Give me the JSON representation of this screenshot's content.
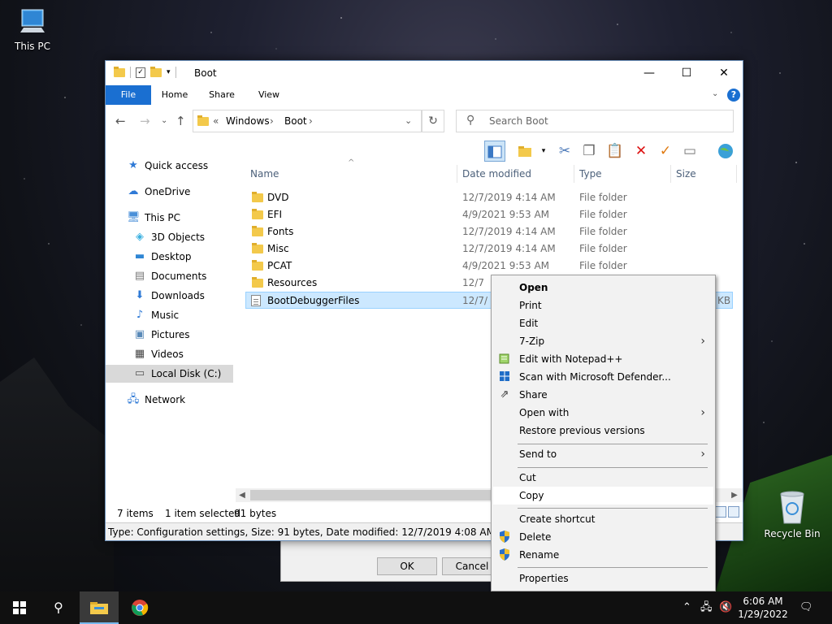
{
  "desktop": {
    "this_pc_label": "This PC",
    "recycle_bin_label": "Recycle Bin"
  },
  "window": {
    "title": "Boot",
    "controls": {
      "minimize": "—",
      "maximize": "☐",
      "close": "✕"
    },
    "ribbon_tabs": [
      "File",
      "Home",
      "Share",
      "View"
    ],
    "address": {
      "prefix": "«",
      "crumbs": [
        "Windows",
        "Boot"
      ]
    },
    "search_placeholder": "Search Boot",
    "nav_pane": [
      {
        "label": "Quick access",
        "icon": "star-icon"
      },
      {
        "label": "OneDrive",
        "icon": "cloud-icon"
      },
      {
        "label": "This PC",
        "icon": "computer-icon"
      },
      {
        "label": "3D Objects",
        "icon": "cube-icon"
      },
      {
        "label": "Desktop",
        "icon": "desktop-icon"
      },
      {
        "label": "Documents",
        "icon": "documents-icon"
      },
      {
        "label": "Downloads",
        "icon": "download-icon"
      },
      {
        "label": "Music",
        "icon": "music-icon"
      },
      {
        "label": "Pictures",
        "icon": "pictures-icon"
      },
      {
        "label": "Videos",
        "icon": "videos-icon"
      },
      {
        "label": "Local Disk (C:)",
        "icon": "drive-icon",
        "selected": true
      },
      {
        "label": "Network",
        "icon": "network-icon"
      }
    ],
    "columns": {
      "name": "Name",
      "date": "Date modified",
      "type": "Type",
      "size": "Size"
    },
    "files": [
      {
        "name": "DVD",
        "date": "12/7/2019 4:14 AM",
        "type": "File folder",
        "size": ""
      },
      {
        "name": "EFI",
        "date": "4/9/2021 9:53 AM",
        "type": "File folder",
        "size": ""
      },
      {
        "name": "Fonts",
        "date": "12/7/2019 4:14 AM",
        "type": "File folder",
        "size": ""
      },
      {
        "name": "Misc",
        "date": "12/7/2019 4:14 AM",
        "type": "File folder",
        "size": ""
      },
      {
        "name": "PCAT",
        "date": "4/9/2021 9:53 AM",
        "type": "File folder",
        "size": ""
      },
      {
        "name": "Resources",
        "date": "12/7",
        "type": "",
        "size": ""
      },
      {
        "name": "BootDebuggerFiles",
        "date": "12/7/",
        "type": "",
        "size": "KB",
        "selected": true
      }
    ],
    "status": {
      "count": "7 items",
      "selected": "1 item selected",
      "size": "91 bytes",
      "info": "Type: Configuration settings, Size: 91 bytes, Date modified: 12/7/2019 4:08 AM"
    }
  },
  "dialog": {
    "ok": "OK",
    "cancel": "Cancel"
  },
  "context_menu": [
    {
      "label": "Open",
      "bold": true
    },
    {
      "label": "Print"
    },
    {
      "label": "Edit"
    },
    {
      "label": "7-Zip",
      "submenu": true
    },
    {
      "label": "Edit with Notepad++",
      "icon": "notepad-icon"
    },
    {
      "label": "Scan with Microsoft Defender...",
      "icon": "defender-icon"
    },
    {
      "label": "Share",
      "icon": "share-icon"
    },
    {
      "label": "Open with",
      "submenu": true
    },
    {
      "label": "Restore previous versions"
    },
    {
      "label": "Send to",
      "submenu": true
    },
    {
      "label": "Cut"
    },
    {
      "label": "Copy",
      "hover": true
    },
    {
      "label": "Create shortcut"
    },
    {
      "label": "Delete",
      "icon": "uac-shield-icon"
    },
    {
      "label": "Rename",
      "icon": "uac-shield-icon"
    },
    {
      "label": "Properties"
    }
  ],
  "taskbar": {
    "time": "6:06 AM",
    "date": "1/29/2022"
  },
  "colors": {
    "accent": "#1a6fd1",
    "selection": "#cce8ff",
    "folder": "#f3c94b"
  }
}
